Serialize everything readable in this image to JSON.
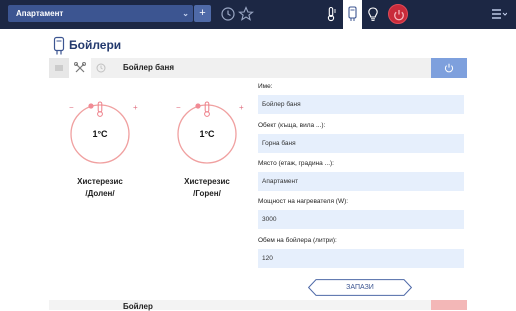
{
  "topbar": {
    "location_select": "Апартамент",
    "add_label": "+",
    "accent": "#1c2744"
  },
  "page": {
    "title": "Бойлери"
  },
  "device": {
    "name": "Бойлер баня",
    "dials": [
      {
        "value": "1°C",
        "label_line1": "Хистерезис",
        "label_line2": "/Долен/",
        "minus": "−",
        "plus": "+"
      },
      {
        "value": "1°C",
        "label_line1": "Хистерезис",
        "label_line2": "/Горен/",
        "minus": "−",
        "plus": "+"
      }
    ],
    "form": {
      "name_label": "Име:",
      "name_value": "Бойлер баня",
      "object_label": "Обект (къща, вила ...):",
      "object_value": "Горна баня",
      "place_label": "Място (етаж, градина ...):",
      "place_value": "Апартамент",
      "power_label": "Мощност на нагревателя (W):",
      "power_value": "3000",
      "volume_label": "Обем на бойлера (литри):",
      "volume_value": "120",
      "save_label": "ЗАПАЗИ"
    }
  },
  "next_device": {
    "name": "Бойлер"
  },
  "colors": {
    "dial_ring": "#f0a0a0",
    "field_bg": "#e6effc",
    "power_active": "#7ea0dd",
    "power_off": "#f3b7b7"
  }
}
